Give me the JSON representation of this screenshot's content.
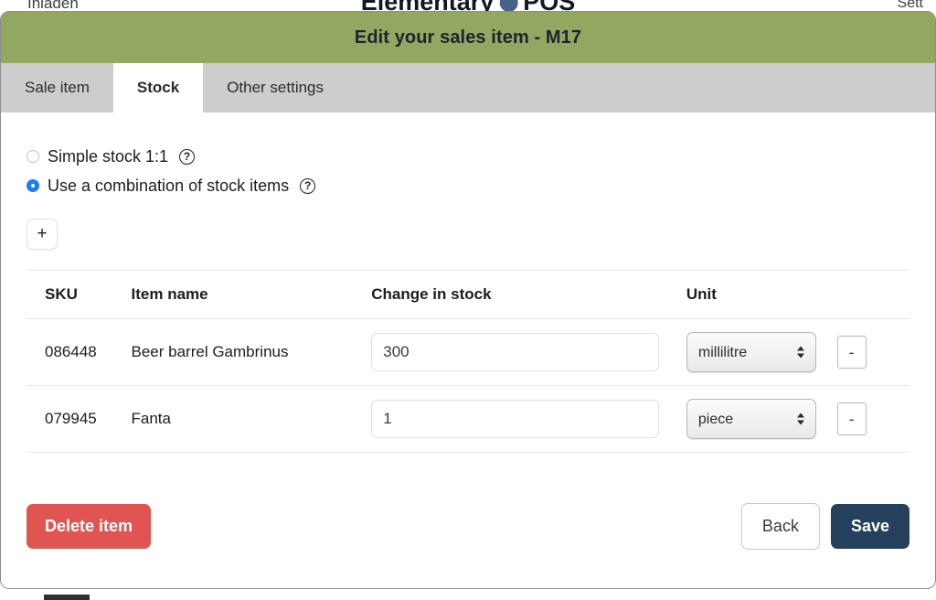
{
  "background": {
    "left_text": "Inladen",
    "logo_text_start": "Elementary",
    "logo_text_end": "POS",
    "right_text": "Sett"
  },
  "modal": {
    "title": "Edit your sales item - M17",
    "header_color": "#93a761",
    "tabs": [
      {
        "label": "Sale item",
        "active": false
      },
      {
        "label": "Stock",
        "active": true
      },
      {
        "label": "Other settings",
        "active": false
      }
    ],
    "stock_mode": {
      "options": [
        {
          "label": "Simple stock 1:1",
          "selected": false,
          "help": "?"
        },
        {
          "label": "Use a combination of stock items",
          "selected": true,
          "help": "?"
        }
      ],
      "selected_color": "#1b7df5"
    },
    "add_row_label": "+",
    "table": {
      "columns": [
        "SKU",
        "Item name",
        "Change in stock",
        "Unit"
      ],
      "rows": [
        {
          "sku": "086448",
          "name": "Beer barrel Gambrinus",
          "change_in_stock": "300",
          "unit": "millilitre",
          "remove_label": "-"
        },
        {
          "sku": "079945",
          "name": "Fanta",
          "change_in_stock": "1",
          "unit": "piece",
          "remove_label": "-"
        }
      ]
    },
    "footer": {
      "delete_label": "Delete item",
      "back_label": "Back",
      "save_label": "Save",
      "delete_color": "#e05552",
      "save_color": "#24405c"
    }
  }
}
